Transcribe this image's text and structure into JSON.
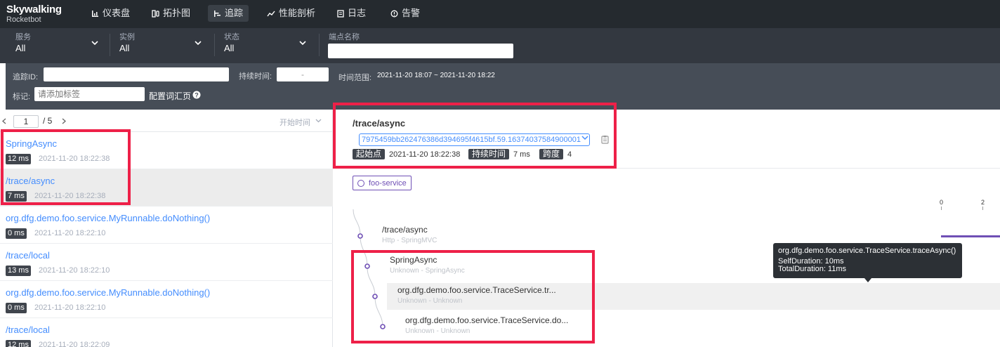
{
  "brand": {
    "name": "Skywalking",
    "sub": "Rocketbot"
  },
  "nav": [
    {
      "label": "仪表盘",
      "icon": "dashboard-icon"
    },
    {
      "label": "拓扑图",
      "icon": "topology-icon"
    },
    {
      "label": "追踪",
      "icon": "trace-icon",
      "active": true
    },
    {
      "label": "性能剖析",
      "icon": "profile-icon"
    },
    {
      "label": "日志",
      "icon": "log-icon"
    },
    {
      "label": "告警",
      "icon": "alarm-icon"
    }
  ],
  "filters": {
    "service": {
      "label": "服务",
      "value": "All"
    },
    "instance": {
      "label": "实例",
      "value": "All"
    },
    "status": {
      "label": "状态",
      "value": "All"
    },
    "endpoint": {
      "label": "端点名称",
      "value": ""
    }
  },
  "search": {
    "trace_id_label": "追踪ID:",
    "trace_id_value": "",
    "duration_label": "持续时间:",
    "duration_value": "-",
    "time_range_label": "时间范围:",
    "time_range_value": "2021-11-20 18:07 ~ 2021-11-20 18:22",
    "tags_label": "标记:",
    "tags_placeholder": "请添加标签",
    "config_label": "配置词汇页"
  },
  "pager": {
    "current": "1",
    "total": "/ 5",
    "sort_label": "开始时间"
  },
  "traces": [
    {
      "name": "SpringAsync",
      "duration": "12 ms",
      "time": "2021-11-20 18:22:38"
    },
    {
      "name": "/trace/async",
      "duration": "7 ms",
      "time": "2021-11-20 18:22:38",
      "selected": true
    },
    {
      "name": "org.dfg.demo.foo.service.MyRunnable.doNothing()",
      "duration": "0 ms",
      "time": "2021-11-20 18:22:10"
    },
    {
      "name": "/trace/local",
      "duration": "13 ms",
      "time": "2021-11-20 18:22:10"
    },
    {
      "name": "org.dfg.demo.foo.service.MyRunnable.doNothing()",
      "duration": "0 ms",
      "time": "2021-11-20 18:22:10"
    },
    {
      "name": "/trace/local",
      "duration": "12 ms",
      "time": "2021-11-20 18:22:09"
    }
  ],
  "detail": {
    "title": "/trace/async",
    "trace_id": "7975459bb262476386d394695f4615bf.59.16374037584900001",
    "start_label": "起始点",
    "start_value": "2021-11-20 18:22:38",
    "duration_label": "持续时间",
    "duration_value": "7 ms",
    "spans_label": "跨度",
    "spans_value": "4",
    "service": "foo-service",
    "ruler": [
      "0",
      "2"
    ]
  },
  "spans": [
    {
      "name": "/trace/async",
      "sub": "Http - SpringMVC"
    },
    {
      "name": "SpringAsync",
      "sub": "Unknown - SpringAsync"
    },
    {
      "name": "org.dfg.demo.foo.service.TraceService.tr...",
      "sub": "Unknown - Unknown"
    },
    {
      "name": "org.dfg.demo.foo.service.TraceService.do...",
      "sub": "Unknown - Unknown"
    }
  ],
  "tooltip": {
    "title": "org.dfg.demo.foo.service.TraceService.traceAsync()",
    "self": "SelfDuration: 10ms",
    "total": "TotalDuration: 11ms"
  },
  "colors": {
    "accent": "#448dfe",
    "service": "#6f4fb5",
    "annotation": "#ee2048"
  }
}
